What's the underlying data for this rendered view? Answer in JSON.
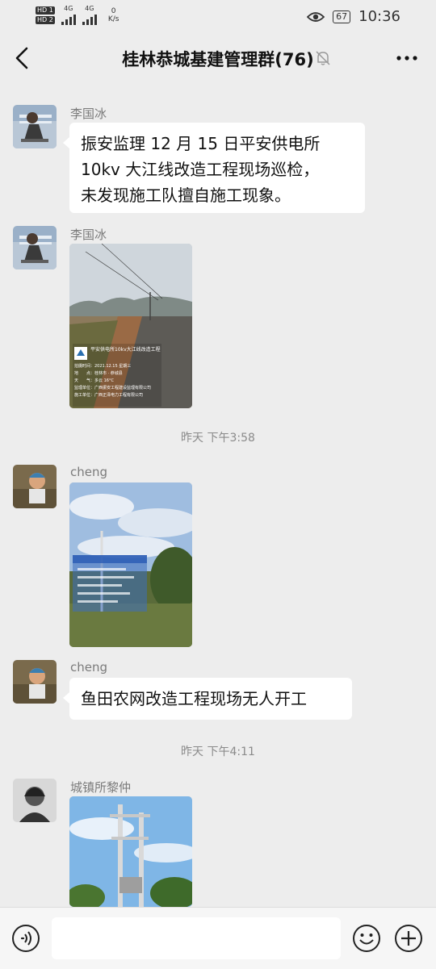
{
  "status_bar": {
    "hd1": "HD 1",
    "hd2": "HD 2",
    "net_a": "4G",
    "net_b": "4G",
    "speed_value": "0",
    "speed_unit": "K/s",
    "battery": "67",
    "time": "10:36"
  },
  "header": {
    "title": "桂林恭城基建管理群(76)",
    "mute_icon": "bell-off-icon",
    "more_icon": "more-icon",
    "back_icon": "chevron-left-icon"
  },
  "messages": [
    {
      "sender": "李国冰",
      "type": "text",
      "text_lines": [
        "振安监理 12 月 15 日平安供电所",
        "10kv 大江线改造工程现场巡检，",
        "未发现施工队擅自施工现象。"
      ]
    },
    {
      "sender": "李国冰",
      "type": "image",
      "watermark_title": "平安供电所10kv大江线改造工程",
      "watermark_rows": [
        "拍摄时间：2021.12.15 星期三",
        "地　　点：桂林市 · 恭城县",
        "天　　气：多云 16°C",
        "监理单位：广西振安工程建设监理有限公司",
        "施工单位：广西正泽电力工程有限公司"
      ]
    },
    {
      "sender": "cheng",
      "type": "image"
    },
    {
      "sender": "cheng",
      "type": "text",
      "text_lines": [
        "鱼田农网改造工程现场无人开工"
      ]
    },
    {
      "sender": "城镇所黎仲",
      "type": "image"
    }
  ],
  "timestamps": [
    "昨天 下午3:58",
    "昨天 下午4:11"
  ],
  "input_bar": {
    "placeholder": "",
    "voice_icon": "voice-icon",
    "emoji_icon": "emoji-icon",
    "plus_icon": "plus-icon"
  }
}
